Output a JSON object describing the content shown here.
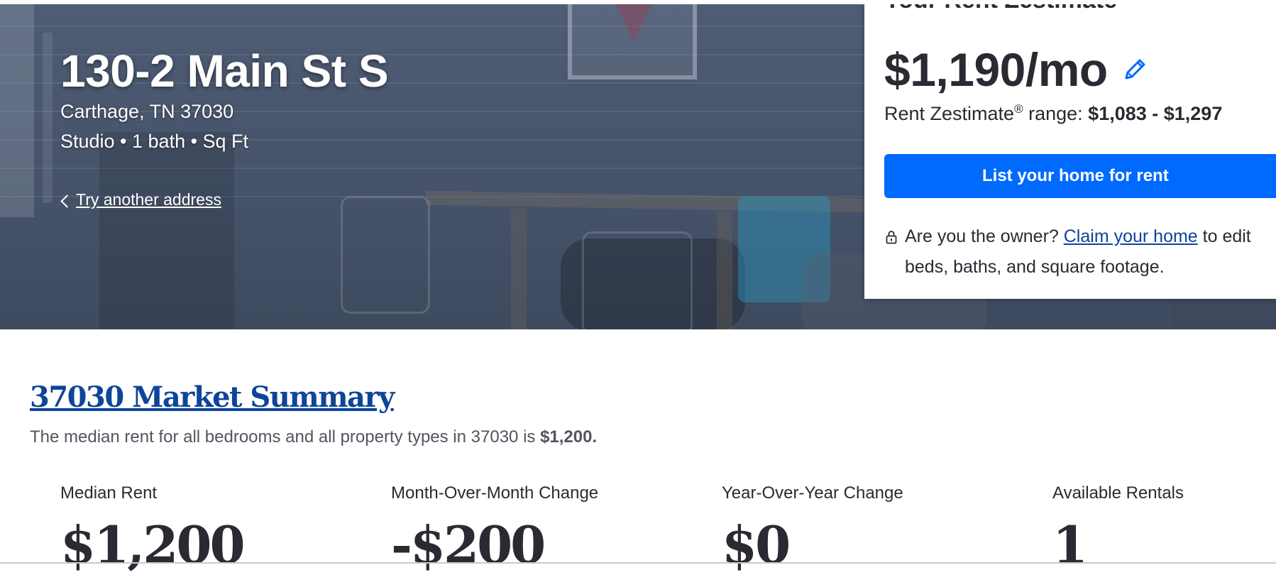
{
  "hero": {
    "address_title": "130-2 Main St S",
    "city_state_zip": "Carthage, TN 37030",
    "facts": "Studio • 1 bath • Sq Ft",
    "try_another_label": "Try another address"
  },
  "estimate_card": {
    "heading": "Your Rent Zestimate",
    "rent_value": "$1,190/mo",
    "range_label": "Rent Zestimate",
    "range_registered": "®",
    "range_suffix": " range: ",
    "range_value": "$1,083 - $1,297",
    "cta_label": "List your home for rent",
    "owner_prefix": "Are you the owner? ",
    "owner_link": "Claim your home",
    "owner_suffix": " to edit beds, baths, and square footage.",
    "icons": [
      "pencil-icon",
      "lock-icon"
    ],
    "accent_color": "#006aff"
  },
  "market": {
    "title": "37030 Market Summary",
    "desc_prefix": "The median rent for all bedrooms and all property types in 37030 is ",
    "desc_value": "$1,200.",
    "stats": [
      {
        "label": "Median Rent",
        "value": "$1,200"
      },
      {
        "label": "Month-Over-Month Change",
        "value": "-$200"
      },
      {
        "label": "Year-Over-Year Change",
        "value": "$0"
      },
      {
        "label": "Available Rentals",
        "value": "1"
      }
    ]
  }
}
